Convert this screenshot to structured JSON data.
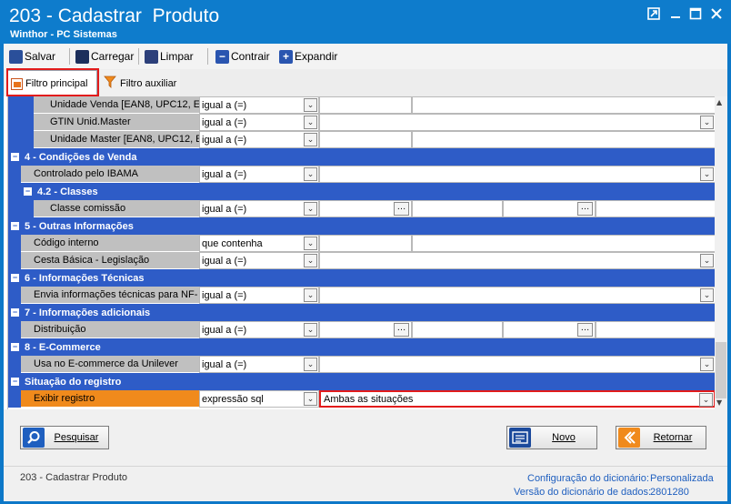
{
  "window": {
    "title": "203 - Cadastrar  Produto",
    "subtitle": "Winthor - PC Sistemas",
    "controls": [
      "restore",
      "minimize",
      "maximize",
      "close"
    ]
  },
  "toolbar": {
    "save_label": "Salvar",
    "load_label": "Carregar",
    "clear_label": "Limpar",
    "collapse_label": "Contrair",
    "expand_label": "Expandir"
  },
  "tabs": {
    "main_label": "Filtro principal",
    "aux_label": "Filtro auxiliar"
  },
  "grid": {
    "rows": [
      {
        "kind": "field",
        "label": "Unidade Venda [EAN8, UPC12, EA",
        "op": "igual a (=)",
        "value": "",
        "indent": 2
      },
      {
        "kind": "field",
        "label": "GTIN Unid.Master",
        "op": "igual a (=)",
        "value": "",
        "indent": 2,
        "value_dropdown": true
      },
      {
        "kind": "field",
        "label": "Unidade Master [EAN8, UPC12, E",
        "op": "igual a (=)",
        "value": "",
        "indent": 2
      },
      {
        "kind": "category",
        "label": "4 - Condições de Venda"
      },
      {
        "kind": "field",
        "label": "Controlado pelo IBAMA",
        "op": "igual a (=)",
        "value": "",
        "indent": 1,
        "value_dropdown": true
      },
      {
        "kind": "subcategory",
        "label": "4.2 - Classes"
      },
      {
        "kind": "field",
        "label": "Classe comissão",
        "op": "igual a (=)",
        "value": "",
        "indent": 2,
        "range": true
      },
      {
        "kind": "category",
        "label": "5 - Outras Informações"
      },
      {
        "kind": "field",
        "label": "Código interno",
        "op": "que contenha",
        "value": "",
        "indent": 1
      },
      {
        "kind": "field",
        "label": "Cesta Básica - Legislação",
        "op": "igual a (=)",
        "value": "",
        "indent": 1,
        "value_dropdown": true
      },
      {
        "kind": "category",
        "label": "6 - Informações Técnicas"
      },
      {
        "kind": "field",
        "label": "Envia informações técnicas para NF-",
        "op": "igual a (=)",
        "value": "",
        "indent": 1,
        "value_dropdown": true
      },
      {
        "kind": "category",
        "label": "7 - Informações adicionais"
      },
      {
        "kind": "field",
        "label": "Distribuição",
        "op": "igual a (=)",
        "value": "",
        "indent": 1,
        "range": true
      },
      {
        "kind": "category",
        "label": "8 - E-Commerce"
      },
      {
        "kind": "field",
        "label": "Usa no E-commerce da Unilever",
        "op": "igual a (=)",
        "value": "",
        "indent": 1,
        "value_dropdown": true
      },
      {
        "kind": "category",
        "label": "Situação do registro"
      },
      {
        "kind": "field",
        "label": "Exibir registro",
        "op": "expressão sql",
        "value": "Ambas as situações",
        "indent": 1,
        "value_dropdown": true,
        "selected": true
      }
    ]
  },
  "buttons": {
    "search_label": "Pesquisar",
    "new_label": "Novo",
    "return_label": "Retornar"
  },
  "status": {
    "routine": "203 - Cadastrar  Produto",
    "config_label": "Configuração do dicionário:",
    "config_value": "Personalizada",
    "version_label": "Versão do dicionário de dados:",
    "version_value": "2801280"
  },
  "colors": {
    "titlebar": "#0e7ccc",
    "category": "#2e5cc7",
    "selected_label": "#f08a1c",
    "highlight": "#e21b1b",
    "status_value": "#1f5fbf"
  }
}
